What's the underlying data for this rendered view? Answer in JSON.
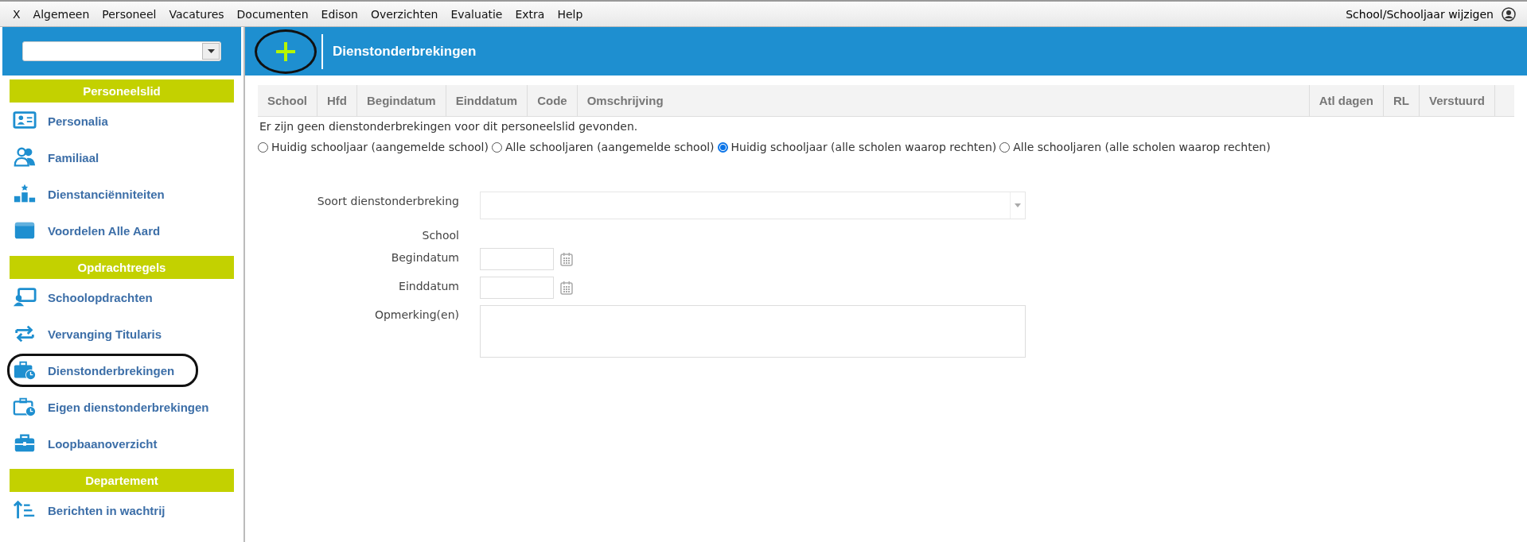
{
  "menu_bar": {
    "items": [
      "X",
      "Algemeen",
      "Personeel",
      "Vacatures",
      "Documenten",
      "Edison",
      "Overzichten",
      "Evaluatie",
      "Extra",
      "Help"
    ],
    "right_link": "School/Schooljaar wijzigen"
  },
  "sidebar": {
    "sections": [
      {
        "title": "Personeelslid",
        "items": [
          {
            "label": "Personalia",
            "circled": false
          },
          {
            "label": "Familiaal",
            "circled": false
          },
          {
            "label": "Dienstanciënniteiten",
            "circled": false
          },
          {
            "label": "Voordelen Alle Aard",
            "circled": false
          }
        ]
      },
      {
        "title": "Opdrachtregels",
        "items": [
          {
            "label": "Schoolopdrachten",
            "circled": false
          },
          {
            "label": "Vervanging Titularis",
            "circled": false
          },
          {
            "label": "Dienstonderbrekingen",
            "circled": true
          },
          {
            "label": "Eigen dienstonderbrekingen",
            "circled": false
          },
          {
            "label": "Loopbaanoverzicht",
            "circled": false
          }
        ]
      },
      {
        "title": "Departement",
        "items": [
          {
            "label": "Berichten in wachtrij",
            "circled": false
          }
        ]
      }
    ]
  },
  "header": {
    "title": "Dienstonderbrekingen",
    "add_button_circled": true
  },
  "table": {
    "columns": [
      "School",
      "Hfd",
      "Begindatum",
      "Einddatum",
      "Code",
      "Omschrijving",
      "Atl dagen",
      "RL",
      "Verstuurd"
    ]
  },
  "empty_message": "Er zijn geen dienstonderbrekingen voor dit personeelslid gevonden.",
  "filters": [
    {
      "label": "Huidig schooljaar (aangemelde school)",
      "selected": false
    },
    {
      "label": "Alle schooljaren (aangemelde school)",
      "selected": false
    },
    {
      "label": "Huidig schooljaar (alle scholen waarop rechten)",
      "selected": true
    },
    {
      "label": "Alle schooljaren (alle scholen waarop rechten)",
      "selected": false
    }
  ],
  "form": {
    "fields": [
      {
        "label": "Soort dienstonderbreking",
        "kind": "select"
      },
      {
        "label": "School",
        "kind": "text"
      },
      {
        "label": "Begindatum",
        "kind": "date"
      },
      {
        "label": "Einddatum",
        "kind": "date"
      },
      {
        "label": "Opmerking(en)",
        "kind": "textarea"
      }
    ]
  }
}
